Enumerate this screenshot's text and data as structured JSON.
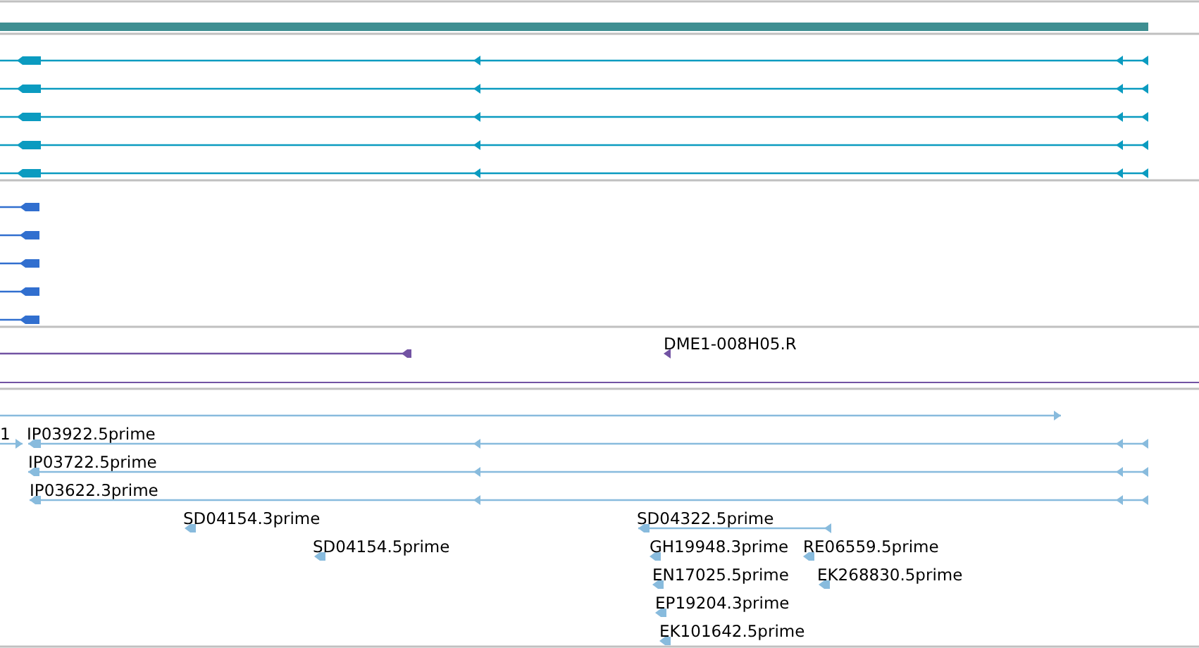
{
  "tracks": [
    {
      "kind": "bar",
      "color": "#3f8f92"
    },
    {
      "kind": "features",
      "color": "#0b9bc0",
      "features": [
        {
          "reverse": true
        },
        {
          "reverse": true
        },
        {
          "reverse": true
        },
        {
          "reverse": true
        },
        {
          "reverse": true
        }
      ]
    },
    {
      "kind": "features",
      "color": "#316fcf",
      "features": [
        {
          "reverse": true
        },
        {
          "reverse": true
        },
        {
          "reverse": true
        },
        {
          "reverse": true
        },
        {
          "reverse": true
        }
      ]
    },
    {
      "kind": "features",
      "color": "#7253a3",
      "features": [
        {
          "reverse": true
        },
        {
          "reverse": true,
          "label": "DME1-008H05.R"
        }
      ]
    },
    {
      "kind": "features",
      "color": "#88bbdd",
      "features": [
        {
          "reverse": false
        },
        {
          "reverse": false,
          "label": "1"
        },
        {
          "reverse": true,
          "label": "IP03922.5prime"
        },
        {
          "reverse": true,
          "label": "IP03722.5prime"
        },
        {
          "reverse": true,
          "label": "IP03622.3prime"
        },
        {
          "reverse": true,
          "label": "SD04154.3prime"
        },
        {
          "reverse": true,
          "label": "SD04154.5prime"
        },
        {
          "reverse": true,
          "label": "SD04322.5prime"
        },
        {
          "reverse": true,
          "label": "GH19948.3prime"
        },
        {
          "reverse": true,
          "label": "RE06559.5prime"
        },
        {
          "reverse": true,
          "label": "EN17025.5prime"
        },
        {
          "reverse": true,
          "label": "EK268830.5prime"
        },
        {
          "reverse": true,
          "label": "EP19204.3prime"
        },
        {
          "reverse": true,
          "label": "EK101642.5prime"
        }
      ]
    }
  ]
}
